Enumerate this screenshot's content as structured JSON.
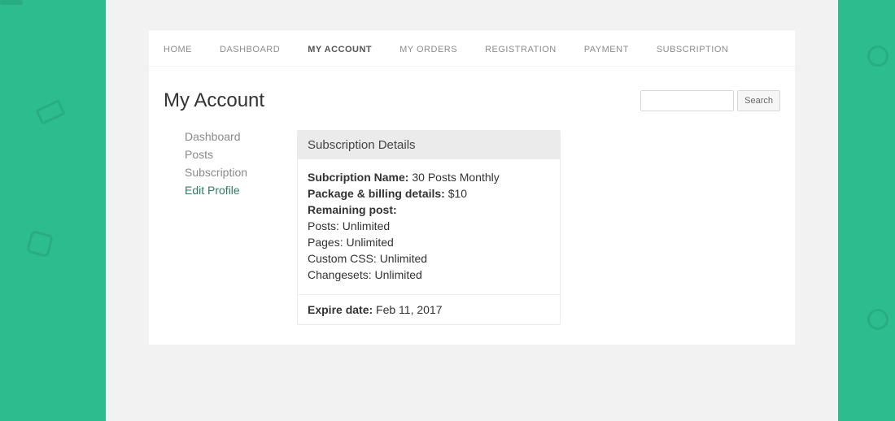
{
  "nav": {
    "items": [
      "HOME",
      "DASHBOARD",
      "MY ACCOUNT",
      "MY ORDERS",
      "REGISTRATION",
      "PAYMENT",
      "SUBSCRIPTION"
    ],
    "active_index": 2
  },
  "page_title": "My Account",
  "search": {
    "placeholder": "",
    "button_label": "Search"
  },
  "sidebar": {
    "items": [
      {
        "label": "Dashboard",
        "accent": false
      },
      {
        "label": "Posts",
        "accent": false
      },
      {
        "label": "Subscription",
        "accent": false
      },
      {
        "label": "Edit Profile",
        "accent": true
      }
    ]
  },
  "panel": {
    "header": "Subscription Details",
    "name_label": "Subcription Name:",
    "name_value": "30 Posts Monthly",
    "billing_label": "Package & billing details:",
    "billing_value": "$10",
    "remaining_label": "Remaining post:",
    "lines": [
      "Posts: Unlimited",
      "Pages: Unlimited",
      "Custom CSS: Unlimited",
      "Changesets: Unlimited"
    ],
    "expire_label": "Expire date:",
    "expire_value": "Feb 11, 2017"
  }
}
